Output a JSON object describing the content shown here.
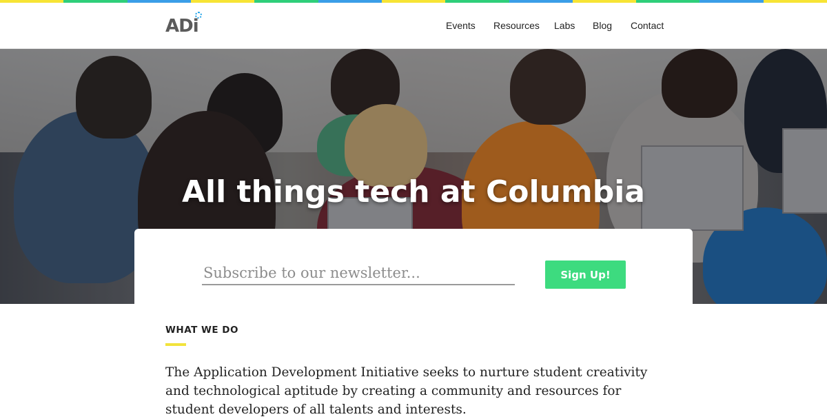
{
  "colors": {
    "stripe": [
      "#f7e435",
      "#2fcf7a",
      "#3a9ee8",
      "#f7e435",
      "#2fcf7a",
      "#3a9ee8",
      "#f7e435",
      "#2fcf7a",
      "#3a9ee8",
      "#f7e435",
      "#2fcf7a",
      "#3a9ee8",
      "#f7e435"
    ],
    "accent_green": "#3ddb7f",
    "accent_yellow": "#f2e33c",
    "logo_gear": "#1aa0e8"
  },
  "logo": {
    "text_a": "AD",
    "text_i": "i",
    "icon": "gear-icon"
  },
  "nav": {
    "items": [
      {
        "label": "Events"
      },
      {
        "label": "Resources"
      },
      {
        "label": "Labs"
      },
      {
        "label": "Blog"
      },
      {
        "label": "Contact"
      }
    ]
  },
  "hero": {
    "title": "All things tech at Columbia",
    "image": "students-with-laptops-photo"
  },
  "subscribe": {
    "placeholder": "Subscribe to our newsletter...",
    "button_label": "Sign Up!"
  },
  "about": {
    "label": "WHAT WE DO",
    "text": "The Application Development Initiative seeks to nurture student creativity and technological aptitude by creating a community and resources for student developers of all talents and interests."
  }
}
